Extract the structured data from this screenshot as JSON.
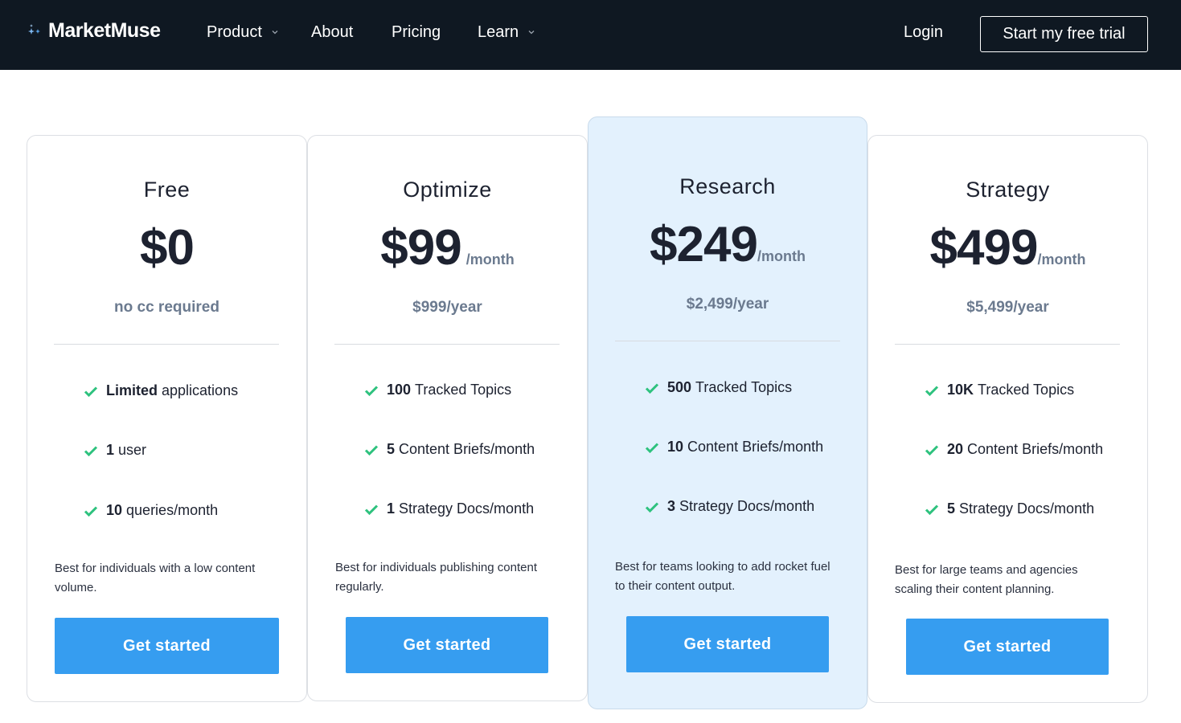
{
  "nav": {
    "logo_text": "MarketMuse",
    "items": [
      {
        "label": "Product",
        "has_dropdown": true
      },
      {
        "label": "About",
        "has_dropdown": false
      },
      {
        "label": "Pricing",
        "has_dropdown": false
      },
      {
        "label": "Learn",
        "has_dropdown": true
      }
    ],
    "login_label": "Login",
    "trial_label": "Start my free trial"
  },
  "colors": {
    "nav_bg": "#0f1822",
    "featured_bg": "#e3f1fd",
    "cta_blue": "#369df0",
    "check_green": "#2ec27e",
    "muted_text": "#6b7a8f"
  },
  "plans": [
    {
      "name": "Free",
      "price": "$0",
      "period": "",
      "sub": "no cc required",
      "features": [
        {
          "bold": "Limited",
          "text": "applications"
        },
        {
          "bold": "1",
          "text": "user"
        },
        {
          "bold": "10",
          "text": "queries/month"
        }
      ],
      "blurb": "Best for individuals with a low content volume.",
      "cta": "Get started"
    },
    {
      "name": "Optimize",
      "price": "$99",
      "period": "/month",
      "sub": "$999/year",
      "features": [
        {
          "bold": "100",
          "text": "Tracked Topics"
        },
        {
          "bold": "5",
          "text": "Content Briefs/month"
        },
        {
          "bold": "1",
          "text": "Strategy Docs/month"
        }
      ],
      "blurb": "Best for individuals publishing content regularly.",
      "cta": "Get started"
    },
    {
      "name": "Research",
      "price": "$249",
      "period": "/month",
      "sub": "$2,499/year",
      "features": [
        {
          "bold": "500",
          "text": "Tracked Topics"
        },
        {
          "bold": "10",
          "text": "Content Briefs/month"
        },
        {
          "bold": "3",
          "text": "Strategy Docs/month"
        }
      ],
      "blurb": "Best for teams looking to add rocket fuel to their content output.",
      "cta": "Get started"
    },
    {
      "name": "Strategy",
      "price": "$499",
      "period": "/month",
      "sub": "$5,499/year",
      "features": [
        {
          "bold": "10K",
          "text": "Tracked Topics"
        },
        {
          "bold": "20",
          "text": "Content Briefs/month"
        },
        {
          "bold": "5",
          "text": "Strategy Docs/month"
        }
      ],
      "blurb": "Best for large teams and agencies scaling their content planning.",
      "cta": "Get started"
    }
  ]
}
